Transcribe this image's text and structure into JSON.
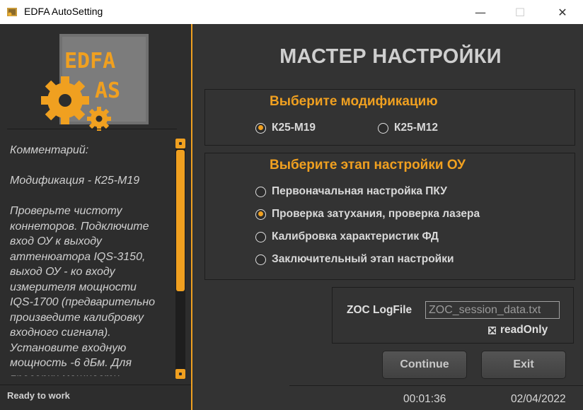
{
  "window": {
    "title": "EDFA AutoSetting",
    "minimize_glyph": "—",
    "maximize_glyph": "☐",
    "close_glyph": "✕"
  },
  "logo": {
    "line1": "EDFA",
    "line2": "AS",
    "accent_color": "#f0a020",
    "panel_color": "#7a7a7a"
  },
  "sidebar": {
    "comment_lines": [
      "Комментарий:",
      "",
      "Модификация - К25-М19",
      "",
      "Проверьте чистоту",
      "коннеторов. Подключите",
      "вход ОУ к выходу",
      "аттенюатора IQS-3150,",
      "выход ОУ - ко входу",
      "измерителя мощности",
      "IQS-1700 (предварительно",
      "произведите калибровку",
      "входного сигнала).",
      "Установите входную",
      "мощность -6 дБм. Для",
      "проверки мощности"
    ],
    "status": "Ready to work"
  },
  "main": {
    "title": "МАСТЕР НАСТРОЙКИ",
    "modification": {
      "title": "Выберите модификацию",
      "options": [
        {
          "label": "К25-М19",
          "checked": true
        },
        {
          "label": "К25-М12",
          "checked": false
        }
      ]
    },
    "stage": {
      "title": "Выберите этап настройки ОУ",
      "options": [
        {
          "label": "Первоначальная настройка ПКУ",
          "checked": false
        },
        {
          "label": "Проверка затухания, проверка лазера",
          "checked": true
        },
        {
          "label": "Калибровка характеристик ФД",
          "checked": false
        },
        {
          "label": "Заключительный этап настройки",
          "checked": false
        }
      ]
    },
    "zoc": {
      "label": "ZOC LogFile",
      "input_value": "ZOC_session_data.txt",
      "readonly_label": "readOnly",
      "readonly_checked": true
    },
    "buttons": {
      "continue": "Continue",
      "exit": "Exit"
    },
    "timer": "00:01:36",
    "date": "02/04/2022"
  },
  "colors": {
    "accent": "#f0a020",
    "panel_bg": "#333333",
    "sidebar_bg": "#2d2d2d"
  }
}
